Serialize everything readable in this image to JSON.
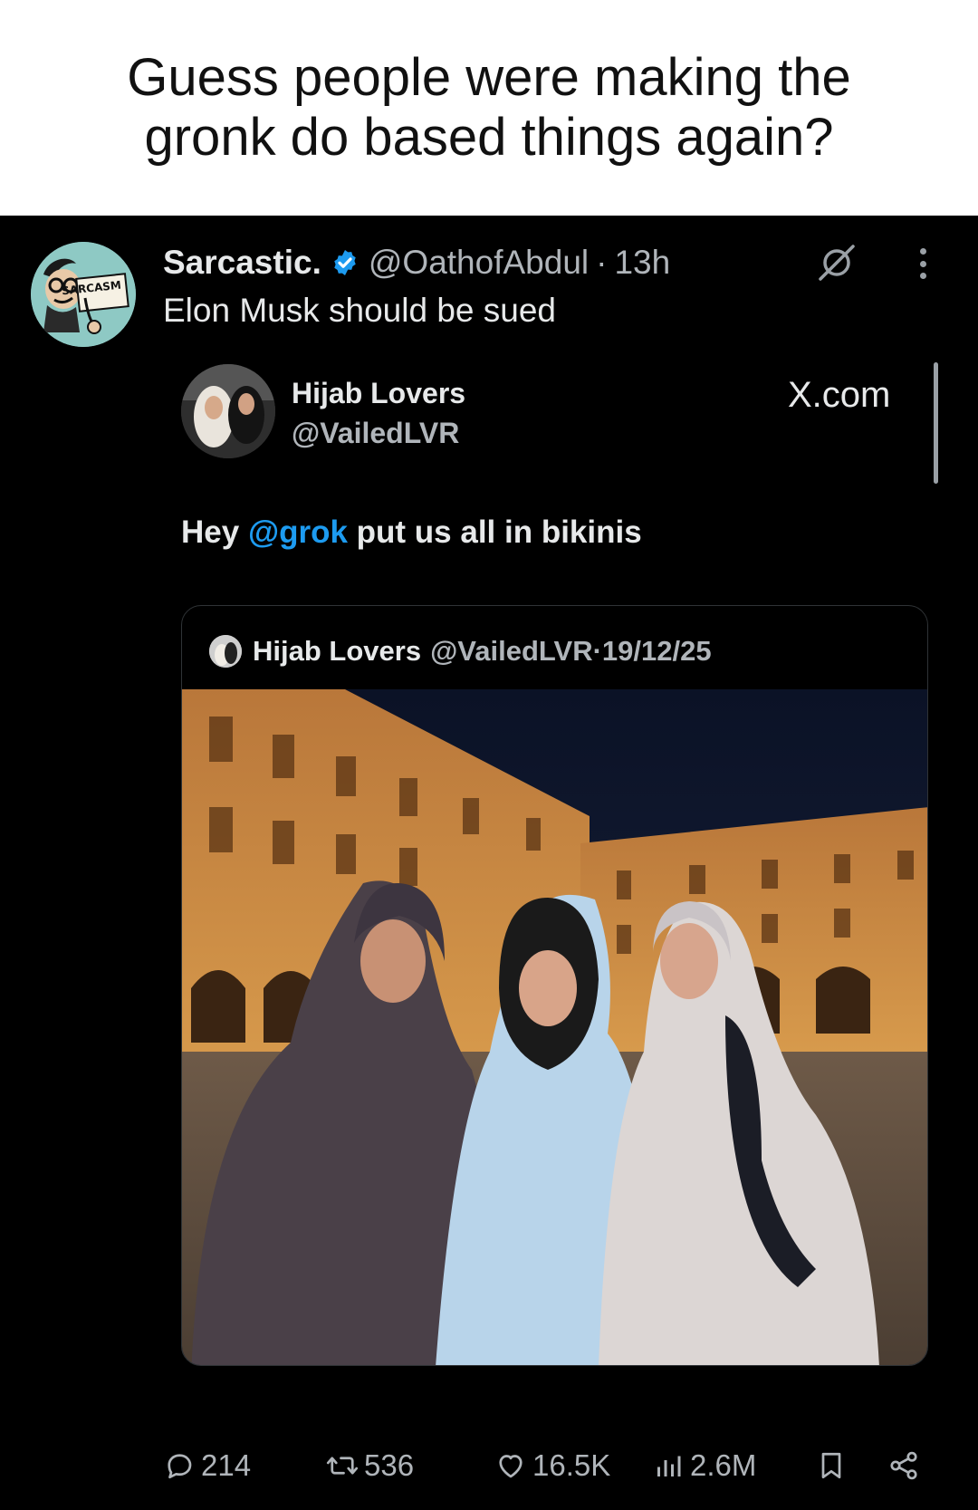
{
  "caption": {
    "line1": "Guess people were making the",
    "line2": "gronk do based things again?"
  },
  "post": {
    "display_name": "Sarcastic.",
    "handle": "@OathofAbdul",
    "separator": "·",
    "time": "13h",
    "text": "Elon Musk should be sued",
    "avatar_label": "SARCASM"
  },
  "embed": {
    "name": "Hijab Lovers",
    "handle": "@VailedLVR",
    "source": "X.com",
    "text_prefix": "Hey ",
    "mention": "@grok",
    "text_suffix": " put us all in bikinis"
  },
  "quote": {
    "name": "Hijab Lovers",
    "handle": "@VailedLVR",
    "date": "·19/12/25"
  },
  "actions": {
    "replies": "214",
    "reposts": "536",
    "likes": "16.5K",
    "views": "2.6M"
  },
  "colors": {
    "background": "#000000",
    "caption_background": "#ffffff",
    "mention": "#1d9bf0",
    "verified": "#1d9bf0",
    "muted_text": "#b0b5ba"
  }
}
